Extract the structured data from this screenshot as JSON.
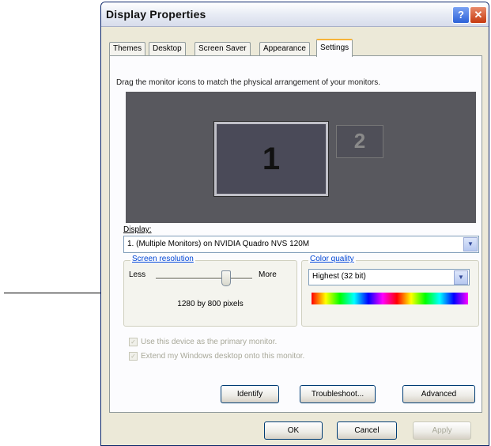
{
  "window": {
    "title": "Display Properties",
    "help_glyph": "?",
    "close_glyph": "✕"
  },
  "tabs": [
    {
      "label": "Themes"
    },
    {
      "label": "Desktop"
    },
    {
      "label": "Screen Saver"
    },
    {
      "label": "Appearance"
    },
    {
      "label": "Settings"
    }
  ],
  "active_tab": "Settings",
  "instruction": "Drag the monitor icons to match the physical arrangement of your monitors.",
  "monitors": [
    {
      "label": "1"
    },
    {
      "label": "2"
    }
  ],
  "display": {
    "label": "Display:",
    "value": "1. (Multiple Monitors) on NVIDIA Quadro NVS 120M",
    "dropdown_glyph": "▼"
  },
  "screen_resolution": {
    "label": "Screen resolution",
    "less": "Less",
    "more": "More",
    "value_text": "1280 by 800 pixels",
    "slider_fraction": 0.72
  },
  "color_quality": {
    "label": "Color quality",
    "value": "Highest (32 bit)",
    "dropdown_glyph": "▼"
  },
  "checkboxes": [
    {
      "label": "Use this device as the primary monitor.",
      "mark": "✓"
    },
    {
      "label": "Extend my Windows desktop onto this monitor.",
      "mark": "✓"
    }
  ],
  "buttons": {
    "identify": "Identify",
    "troubleshoot": "Troubleshoot...",
    "advanced": "Advanced",
    "ok": "OK",
    "cancel": "Cancel",
    "apply": "Apply"
  }
}
